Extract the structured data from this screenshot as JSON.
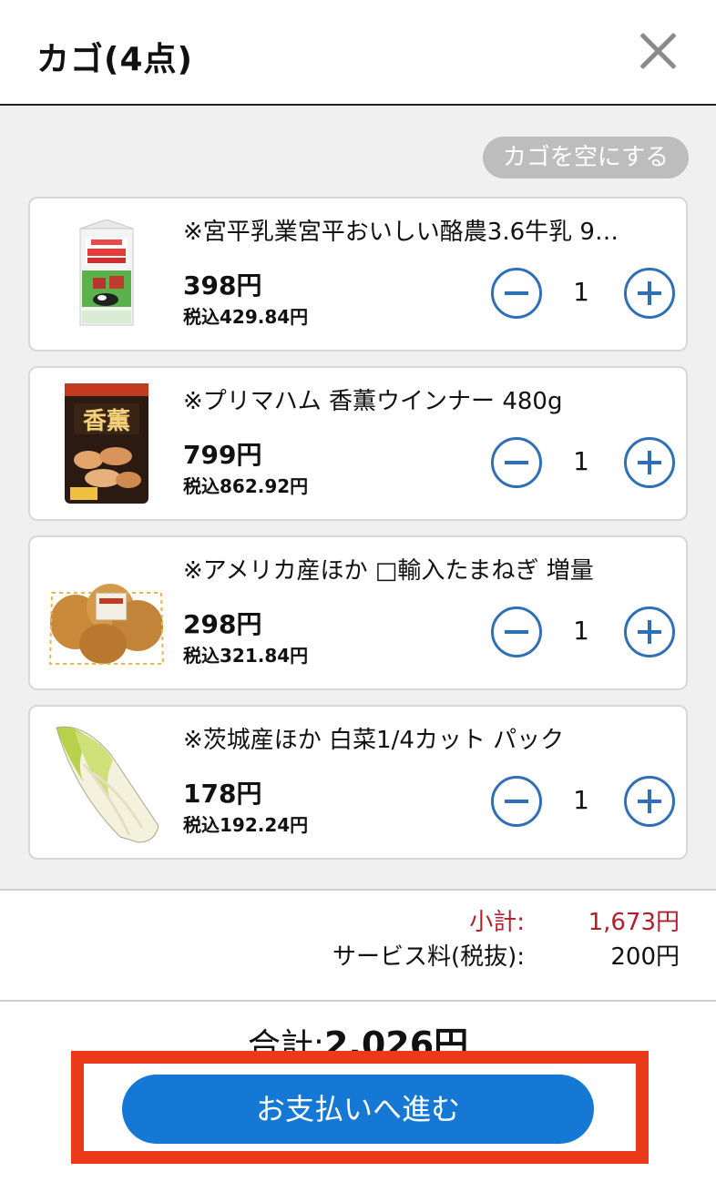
{
  "header": {
    "title": "カゴ(4点)"
  },
  "cart": {
    "empty_label": "カゴを空にする",
    "items": [
      {
        "name": "※宮平乳業宮平おいしい酪農3.6牛乳 9…",
        "price": "398円",
        "tax": "税込429.84円",
        "qty": "1",
        "thumb": "milk-carton"
      },
      {
        "name": "※プリマハム 香薫ウインナー 480g",
        "price": "799円",
        "tax": "税込862.92円",
        "qty": "1",
        "thumb": "sausage-pack"
      },
      {
        "name": "※アメリカ産ほか □輸入たまねぎ  増量",
        "price": "298円",
        "tax": "税込321.84円",
        "qty": "1",
        "thumb": "onions"
      },
      {
        "name": "※茨城産ほか 白菜1/4カット パック",
        "price": "178円",
        "tax": "税込192.24円",
        "qty": "1",
        "thumb": "napa-cabbage"
      }
    ]
  },
  "summary": {
    "subtotal_label": "小計:",
    "subtotal_value": "1,673円",
    "service_label": "サービス料(税抜):",
    "service_value": "200円"
  },
  "total": {
    "label": "合計:",
    "value": "2,026円"
  },
  "pay_button": "お支払いへ進む",
  "colors": {
    "accent": "#1478d4",
    "subtotal": "#b0202a",
    "highlight": "#ea3a19"
  }
}
